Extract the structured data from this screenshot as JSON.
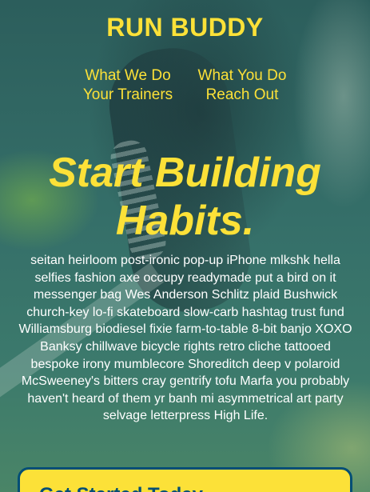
{
  "brand": {
    "name": "RUN BUDDY"
  },
  "nav": {
    "items": [
      {
        "label": "What We Do"
      },
      {
        "label": "What You Do"
      },
      {
        "label": "Your Trainers"
      },
      {
        "label": "Reach Out"
      }
    ]
  },
  "hero": {
    "headline": "Start Building Habits.",
    "body": "seitan heirloom post-ironic pop-up iPhone mlkshk hella selfies fashion axe occupy readymade put a bird on it messenger bag Wes Anderson Schlitz plaid Bushwick church-key lo-fi skateboard slow-carb hashtag trust fund Williamsburg biodiesel fixie farm-to-table 8-bit banjo XOXO Banksy chillwave bicycle rights retro cliche tattooed bespoke irony mumblecore Shoreditch deep v polaroid McSweeney's bitters cray gentrify tofu Marfa you probably haven't heard of them yr banh mi asymmetrical art party selvage letterpress High Life."
  },
  "signup": {
    "title": "Get Started Today"
  },
  "colors": {
    "accent": "#fce138",
    "navy": "#024e76",
    "text": "#ffffff"
  }
}
